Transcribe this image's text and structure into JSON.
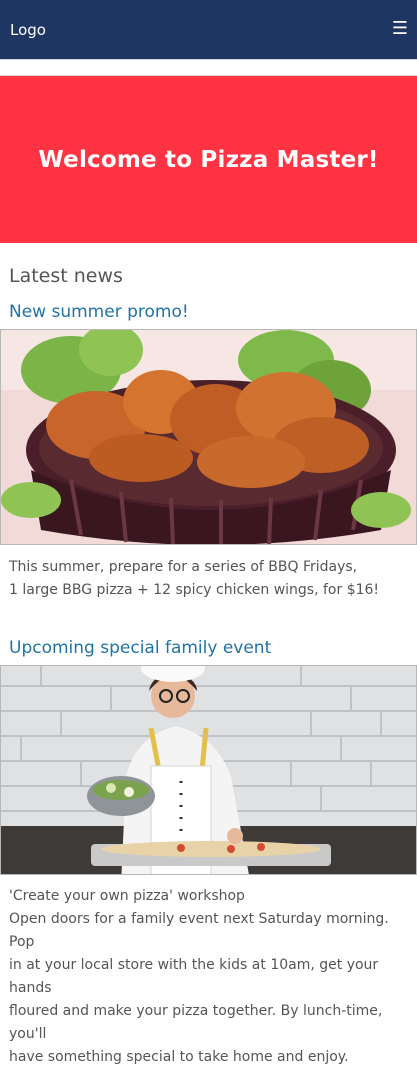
{
  "header": {
    "logo": "Logo",
    "menu_icon": "menu-hamburger-icon",
    "menu_glyph": "☰"
  },
  "hero": {
    "title": "Welcome to Pizza Master!",
    "background": "#ff3341"
  },
  "news": {
    "heading": "Latest news",
    "articles": [
      {
        "title": "New summer promo!",
        "image": "fried-chicken-basket-image",
        "lines": [
          "This summer, prepare for a series of BBQ Fridays,",
          "1 large BBG pizza + 12 spicy chicken wings, for $16!"
        ]
      },
      {
        "title": "Upcoming special family event",
        "image": "child-chef-pizza-image",
        "lines": [
          "'Create your own pizza' workshop",
          "Open doors for a family event next Saturday morning. Pop",
          "in at your local store with the kids at 10am, get your hands",
          "floured and make your pizza together. By lunch-time, you'll",
          "have something special to take home and enjoy."
        ]
      }
    ]
  },
  "colors": {
    "topbar": "#1f3563",
    "hero": "#ff3341",
    "article_title": "#1f73a9",
    "text": "#555555"
  }
}
